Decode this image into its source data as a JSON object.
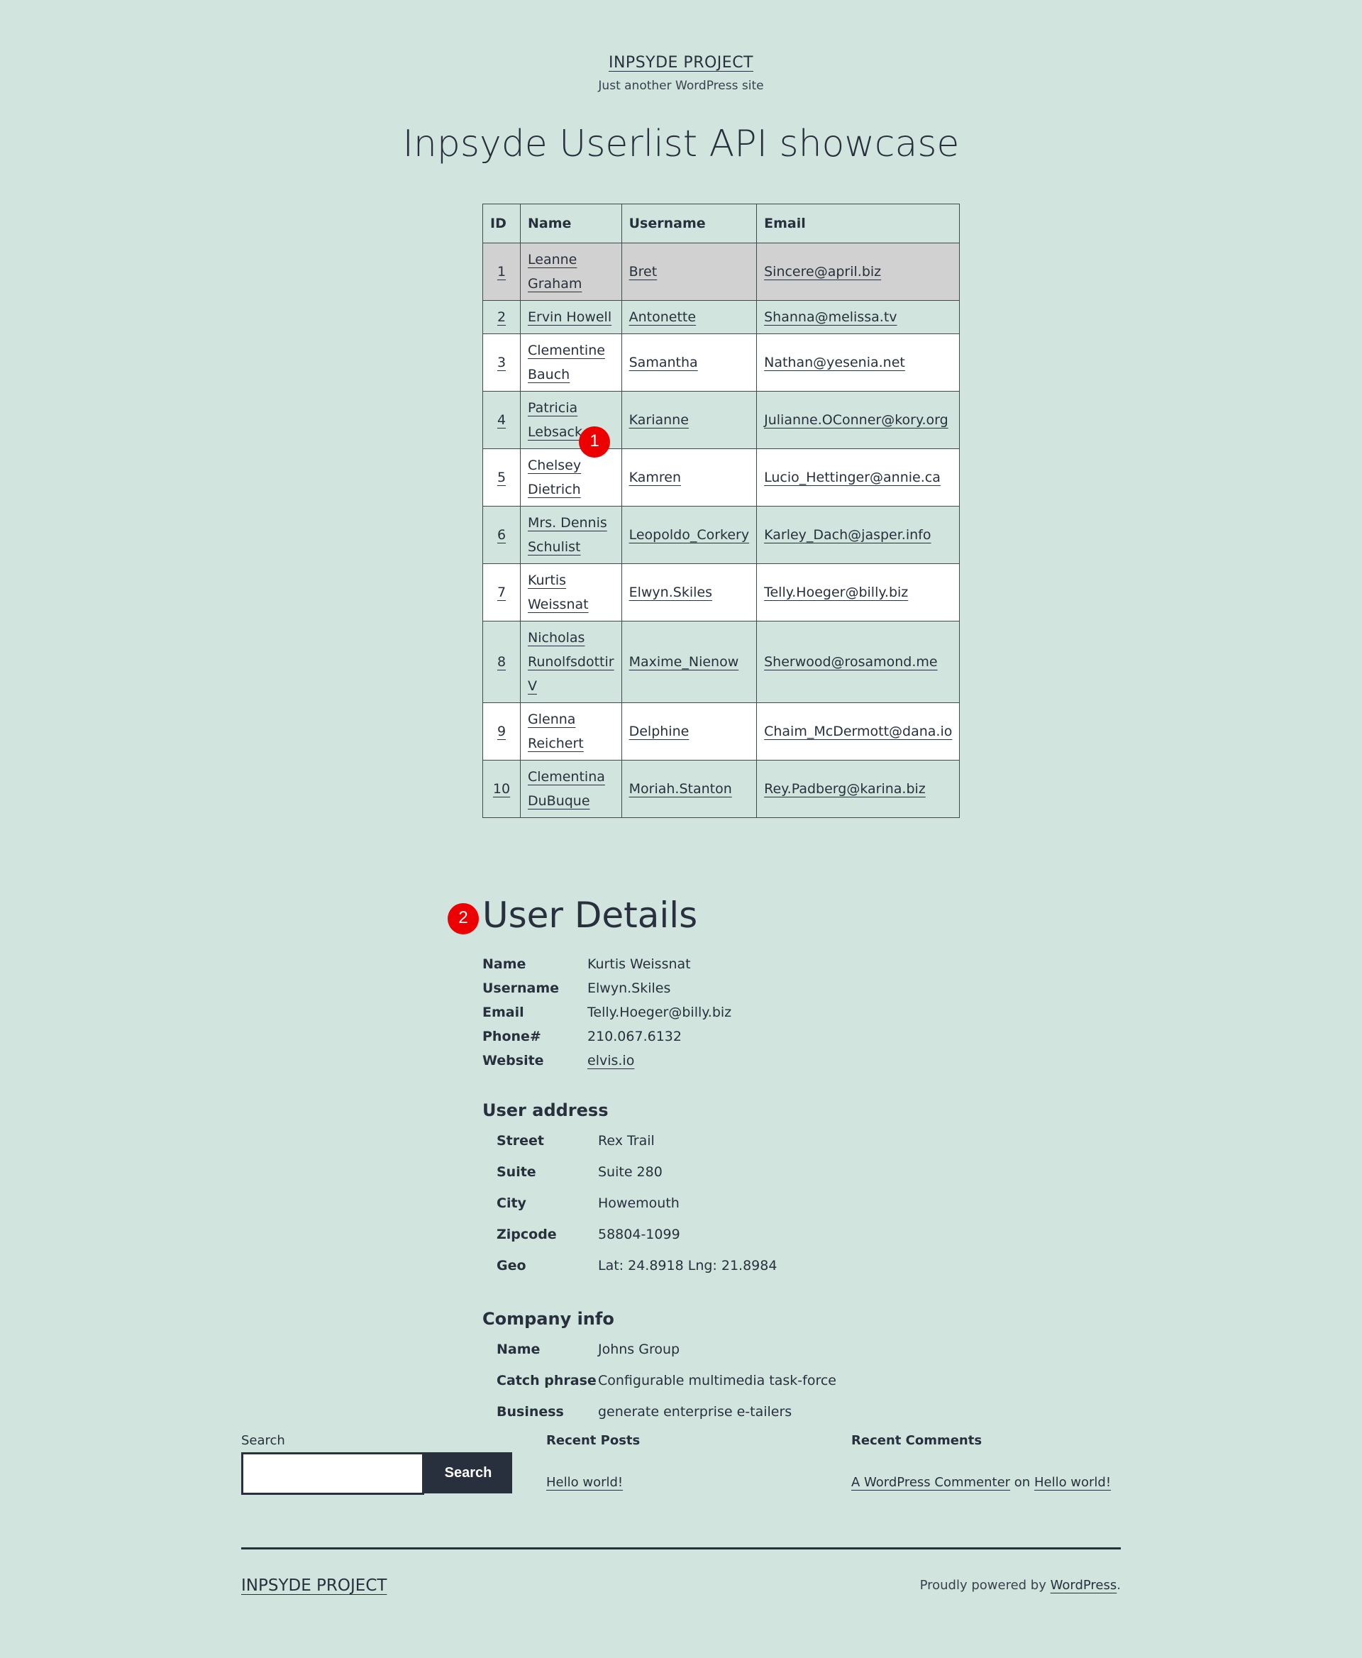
{
  "site": {
    "title": "INPSYDE PROJECT",
    "description": "Just another WordPress site"
  },
  "page": {
    "title": "Inpsyde Userlist API showcase"
  },
  "table": {
    "headers": [
      "ID",
      "Name",
      "Username",
      "Email"
    ],
    "rows": [
      {
        "id": "1",
        "name_line1": "Leanne",
        "name_line2": "Graham",
        "name_line3": "",
        "username": "Bret",
        "email": "Sincere@april.biz"
      },
      {
        "id": "2",
        "name_line1": "Ervin Howell",
        "name_line2": "",
        "name_line3": "",
        "username": "Antonette",
        "email": "Shanna@melissa.tv"
      },
      {
        "id": "3",
        "name_line1": "Clementine",
        "name_line2": "Bauch",
        "name_line3": "",
        "username": "Samantha",
        "email": "Nathan@yesenia.net"
      },
      {
        "id": "4",
        "name_line1": "Patricia",
        "name_line2": "Lebsack",
        "name_line3": "",
        "username": "Karianne",
        "email": "Julianne.OConner@kory.org"
      },
      {
        "id": "5",
        "name_line1": "Chelsey",
        "name_line2": "Dietrich",
        "name_line3": "",
        "username": "Kamren",
        "email": "Lucio_Hettinger@annie.ca"
      },
      {
        "id": "6",
        "name_line1": "Mrs. Dennis",
        "name_line2": "Schulist",
        "name_line3": "",
        "username": "Leopoldo_Corkery",
        "email": "Karley_Dach@jasper.info"
      },
      {
        "id": "7",
        "name_line1": "Kurtis",
        "name_line2": "Weissnat",
        "name_line3": "",
        "username": "Elwyn.Skiles",
        "email": "Telly.Hoeger@billy.biz"
      },
      {
        "id": "8",
        "name_line1": "Nicholas",
        "name_line2": "Runolfsdottir",
        "name_line3": "V",
        "username": "Maxime_Nienow",
        "email": "Sherwood@rosamond.me"
      },
      {
        "id": "9",
        "name_line1": "Glenna",
        "name_line2": "Reichert",
        "name_line3": "",
        "username": "Delphine",
        "email": "Chaim_McDermott@dana.io"
      },
      {
        "id": "10",
        "name_line1": "Clementina",
        "name_line2": "DuBuque",
        "name_line3": "",
        "username": "Moriah.Stanton",
        "email": "Rey.Padberg@karina.biz"
      }
    ]
  },
  "badges": {
    "one": "1",
    "two": "2"
  },
  "details": {
    "heading": "User Details",
    "fields": [
      {
        "label": "Name",
        "value": "Kurtis Weissnat"
      },
      {
        "label": "Username",
        "value": "Elwyn.Skiles"
      },
      {
        "label": "Email",
        "value": "Telly.Hoeger@billy.biz"
      },
      {
        "label": "Phone#",
        "value": "210.067.6132"
      },
      {
        "label": "Website",
        "value": "elvis.io"
      }
    ],
    "address_heading": "User address",
    "address": [
      {
        "label": "Street",
        "value": "Rex Trail"
      },
      {
        "label": "Suite",
        "value": "Suite 280"
      },
      {
        "label": "City",
        "value": "Howemouth"
      },
      {
        "label": "Zipcode",
        "value": "58804-1099"
      },
      {
        "label": "Geo",
        "value": "Lat: 24.8918 Lng: 21.8984"
      }
    ],
    "company_heading": "Company info",
    "company": [
      {
        "label": "Name",
        "value": "Johns Group"
      },
      {
        "label": "Catch phrase",
        "value": "Configurable multimedia task-force"
      },
      {
        "label": "Business",
        "value": "generate enterprise e-tailers"
      }
    ]
  },
  "widgets": {
    "search_label": "Search",
    "search_button": "Search",
    "recent_posts_title": "Recent Posts",
    "recent_post": "Hello world!",
    "recent_comments_title": "Recent Comments",
    "comment_author": "A WordPress Commenter",
    "comment_on": "on",
    "comment_post": "Hello world!"
  },
  "footer": {
    "site_title": "INPSYDE PROJECT",
    "powered_prefix": "Proudly powered by",
    "powered_link": "WordPress",
    "powered_suffix": "."
  },
  "colors": {
    "background": "#d1e4dd",
    "text": "#28303d",
    "highlight_row": "#d1d1d1",
    "badge": "#ee0000"
  }
}
